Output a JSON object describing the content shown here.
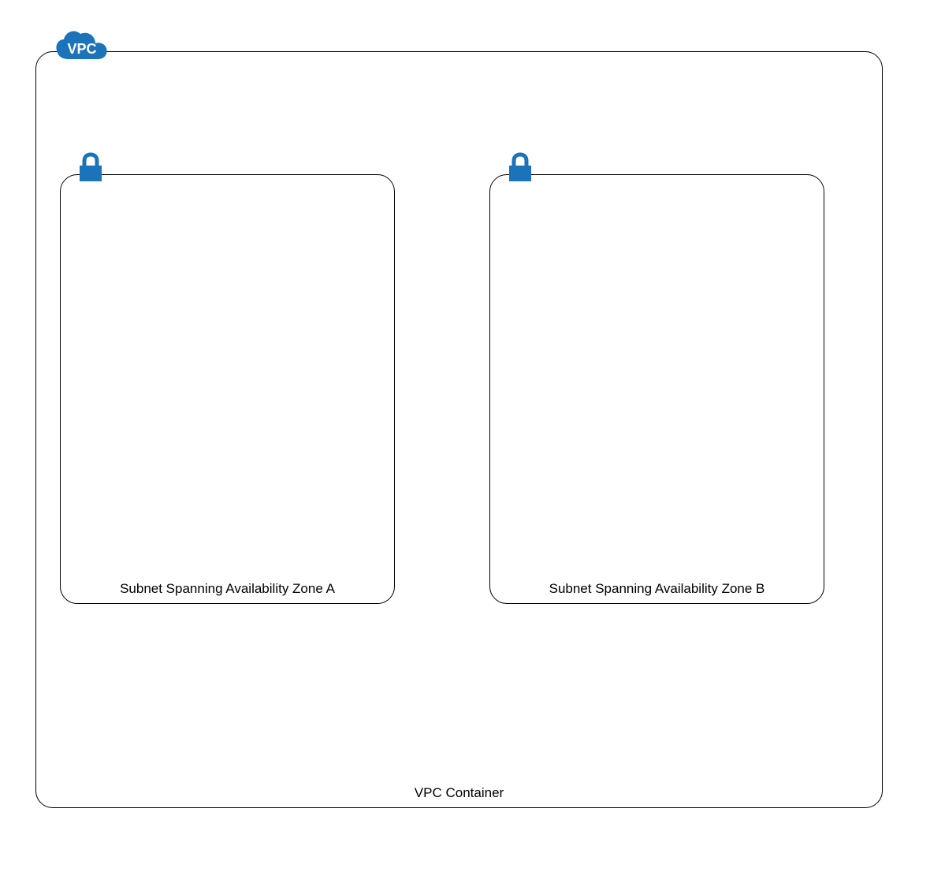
{
  "vpc": {
    "badgeText": "VPC",
    "label": "VPC Container",
    "accentColor": "#1b74ba"
  },
  "subnets": [
    {
      "label": "Subnet Spanning Availability Zone A"
    },
    {
      "label": "Subnet Spanning Availability Zone B"
    }
  ]
}
